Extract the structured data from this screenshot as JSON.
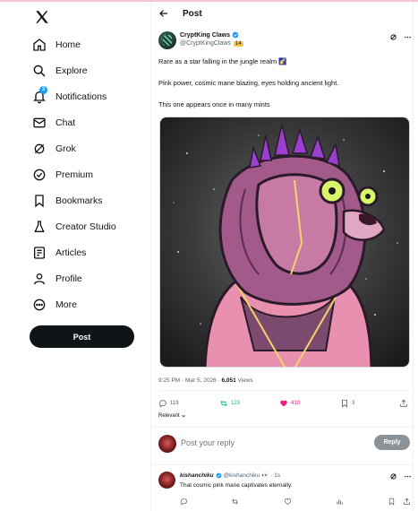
{
  "sidebar": {
    "items": [
      {
        "label": "Home",
        "icon": "home-icon"
      },
      {
        "label": "Explore",
        "icon": "search-icon"
      },
      {
        "label": "Notifications",
        "icon": "bell-icon",
        "badge": "3"
      },
      {
        "label": "Chat",
        "icon": "mail-icon"
      },
      {
        "label": "Grok",
        "icon": "grok-icon"
      },
      {
        "label": "Premium",
        "icon": "premium-icon"
      },
      {
        "label": "Bookmarks",
        "icon": "bookmark-icon"
      },
      {
        "label": "Creator Studio",
        "icon": "flask-icon"
      },
      {
        "label": "Articles",
        "icon": "article-icon"
      },
      {
        "label": "Profile",
        "icon": "person-icon"
      },
      {
        "label": "More",
        "icon": "more-circle-icon"
      }
    ],
    "post_button": "Post"
  },
  "header": {
    "title": "Post"
  },
  "tweet": {
    "author_name": "CryptKing Claws",
    "author_handle": "@CryptKingClaws",
    "handle_badge": "14",
    "lines": [
      "Rare as a star falling in the jungle realm 🌠",
      "Pink power, cosmic mane blazing, eyes holding ancient light.",
      "This one appears once in many mints"
    ],
    "time": "9:25 PM · Mar 5, 2026 · ",
    "views_count": "6,051",
    "views_label": " Views",
    "replies": "119",
    "reposts": "123",
    "likes": "410",
    "bookmarks": "3",
    "sort_label": "Relevant"
  },
  "reply_box": {
    "placeholder": "Post your reply",
    "button": "Reply"
  },
  "reply": {
    "name": "kishanchiku",
    "handle": "@kishanchiku",
    "emoji": "👀",
    "time": "· 1s",
    "text": "That cosmic pink mane captivates eternally."
  },
  "colors": {
    "accent": "#1d9bf0",
    "like": "#f91880",
    "repost": "#00ba7c",
    "badge": "#f7c548"
  }
}
